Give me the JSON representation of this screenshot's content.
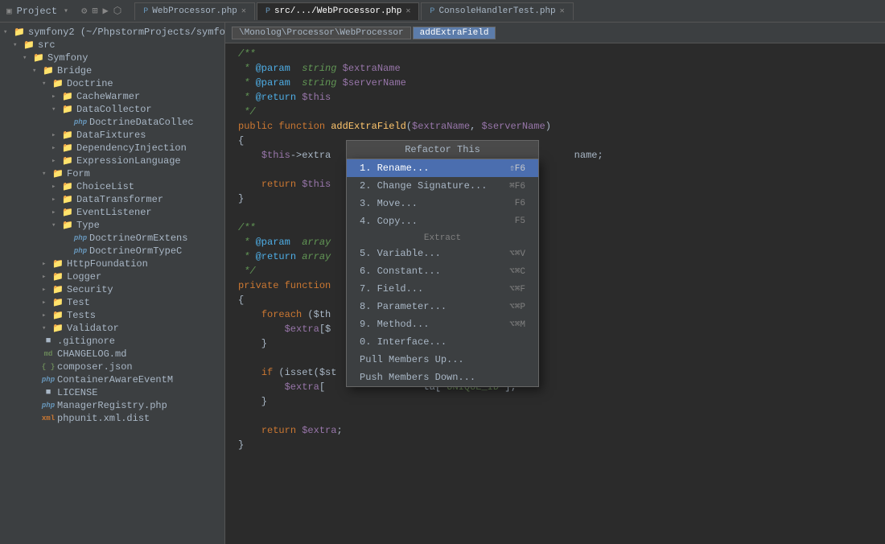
{
  "titlebar": {
    "project_label": "Project",
    "project_path": "symfony2 (~/PhpstormProjects/symfo"
  },
  "tabs": [
    {
      "id": "tab1",
      "label": "WebProcessor.php",
      "active": false,
      "closable": true
    },
    {
      "id": "tab2",
      "label": "src/.../WebProcessor.php",
      "active": true,
      "closable": true
    },
    {
      "id": "tab3",
      "label": "ConsoleHandlerTest.php",
      "active": false,
      "closable": true
    }
  ],
  "breadcrumbs": [
    {
      "label": "\\Monolog\\Processor\\WebProcessor",
      "active": false
    },
    {
      "label": "addExtraField",
      "active": true
    }
  ],
  "sidebar": {
    "items": [
      {
        "id": "symfony2",
        "label": "symfony2 (~/PhpstormProjects/symfo",
        "indent": 0,
        "type": "project",
        "arrow": "▾"
      },
      {
        "id": "src",
        "label": "src",
        "indent": 1,
        "type": "folder-open",
        "arrow": "▾"
      },
      {
        "id": "symfony",
        "label": "Symfony",
        "indent": 2,
        "type": "folder-open",
        "arrow": "▾"
      },
      {
        "id": "bridge",
        "label": "Bridge",
        "indent": 3,
        "type": "folder-open",
        "arrow": "▾"
      },
      {
        "id": "doctrine",
        "label": "Doctrine",
        "indent": 4,
        "type": "folder-open",
        "arrow": "▾"
      },
      {
        "id": "cachewarmer",
        "label": "CacheWarmer",
        "indent": 5,
        "type": "folder",
        "arrow": "▸"
      },
      {
        "id": "datacollector",
        "label": "DataCollector",
        "indent": 5,
        "type": "folder-open",
        "arrow": "▾"
      },
      {
        "id": "doctrinedatacollec",
        "label": "DoctrineDataCollec",
        "indent": 6,
        "type": "php-file",
        "arrow": ""
      },
      {
        "id": "datafixtures",
        "label": "DataFixtures",
        "indent": 5,
        "type": "folder",
        "arrow": "▸"
      },
      {
        "id": "dependencyinjection",
        "label": "DependencyInjection",
        "indent": 5,
        "type": "folder",
        "arrow": "▸"
      },
      {
        "id": "expressionlanguage",
        "label": "ExpressionLanguage",
        "indent": 5,
        "type": "folder",
        "arrow": "▸"
      },
      {
        "id": "form",
        "label": "Form",
        "indent": 4,
        "type": "folder-open",
        "arrow": "▾"
      },
      {
        "id": "choicelist",
        "label": "ChoiceList",
        "indent": 5,
        "type": "folder",
        "arrow": "▸"
      },
      {
        "id": "datatransformer",
        "label": "DataTransformer",
        "indent": 5,
        "type": "folder",
        "arrow": "▸"
      },
      {
        "id": "eventlistener",
        "label": "EventListener",
        "indent": 5,
        "type": "folder",
        "arrow": "▸"
      },
      {
        "id": "type",
        "label": "Type",
        "indent": 5,
        "type": "folder-open",
        "arrow": "▾"
      },
      {
        "id": "doctrineormextens",
        "label": "DoctrineOrmExtens",
        "indent": 6,
        "type": "php-file",
        "arrow": ""
      },
      {
        "id": "doctrineormtypec",
        "label": "DoctrineOrmTypeC",
        "indent": 6,
        "type": "php-file",
        "arrow": ""
      },
      {
        "id": "httpfoundation",
        "label": "HttpFoundation",
        "indent": 4,
        "type": "folder",
        "arrow": "▸"
      },
      {
        "id": "logger",
        "label": "Logger",
        "indent": 4,
        "type": "folder",
        "arrow": "▸"
      },
      {
        "id": "security",
        "label": "Security",
        "indent": 4,
        "type": "folder",
        "arrow": "▸"
      },
      {
        "id": "test",
        "label": "Test",
        "indent": 4,
        "type": "folder",
        "arrow": "▸"
      },
      {
        "id": "tests",
        "label": "Tests",
        "indent": 4,
        "type": "folder",
        "arrow": "▸"
      },
      {
        "id": "validator",
        "label": "Validator",
        "indent": 4,
        "type": "folder-open",
        "arrow": "▾"
      },
      {
        "id": "gitignore",
        "label": ".gitignore",
        "indent": 3,
        "type": "file",
        "arrow": ""
      },
      {
        "id": "changelog",
        "label": "CHANGELOG.md",
        "indent": 3,
        "type": "md-file",
        "arrow": ""
      },
      {
        "id": "composer",
        "label": "composer.json",
        "indent": 3,
        "type": "json-file",
        "arrow": ""
      },
      {
        "id": "containerawareevent",
        "label": "ContainerAwareEventM",
        "indent": 3,
        "type": "php-file",
        "arrow": ""
      },
      {
        "id": "license",
        "label": "LICENSE",
        "indent": 3,
        "type": "file",
        "arrow": ""
      },
      {
        "id": "managerregistry",
        "label": "ManagerRegistry.php",
        "indent": 3,
        "type": "php-file",
        "arrow": ""
      },
      {
        "id": "phpunit",
        "label": "phpunit.xml.dist",
        "indent": 3,
        "type": "xml-file",
        "arrow": ""
      }
    ]
  },
  "context_menu": {
    "title": "Refactor This",
    "items": [
      {
        "id": "rename",
        "label": "1. Rename...",
        "shortcut": "⇧F6",
        "selected": true,
        "section": ""
      },
      {
        "id": "change-sig",
        "label": "2. Change Signature...",
        "shortcut": "⌘F6",
        "selected": false,
        "section": ""
      },
      {
        "id": "move",
        "label": "3. Move...",
        "shortcut": "F6",
        "selected": false,
        "section": ""
      },
      {
        "id": "copy",
        "label": "4. Copy...",
        "shortcut": "F5",
        "selected": false,
        "section": ""
      },
      {
        "id": "extract-section",
        "label": "Extract",
        "shortcut": "",
        "selected": false,
        "section": "header"
      },
      {
        "id": "variable",
        "label": "5. Variable...",
        "shortcut": "⌥⌘V",
        "selected": false,
        "section": ""
      },
      {
        "id": "constant",
        "label": "6. Constant...",
        "shortcut": "⌥⌘C",
        "selected": false,
        "section": ""
      },
      {
        "id": "field",
        "label": "7. Field...",
        "shortcut": "⌥⌘F",
        "selected": false,
        "section": ""
      },
      {
        "id": "parameter",
        "label": "8. Parameter...",
        "shortcut": "⌥⌘P",
        "selected": false,
        "section": ""
      },
      {
        "id": "method",
        "label": "9. Method...",
        "shortcut": "⌥⌘M",
        "selected": false,
        "section": ""
      },
      {
        "id": "interface",
        "label": "0. Interface...",
        "shortcut": "",
        "selected": false,
        "section": ""
      },
      {
        "id": "pull-members",
        "label": "Pull Members Up...",
        "shortcut": "",
        "selected": false,
        "section": ""
      },
      {
        "id": "push-members",
        "label": "Push Members Down...",
        "shortcut": "",
        "selected": false,
        "section": ""
      }
    ]
  },
  "code_lines": [
    {
      "num": "",
      "content": "  /**"
    },
    {
      "num": "",
      "content": "   * @param  string $extraName"
    },
    {
      "num": "",
      "content": "   * @param  string $serverName"
    },
    {
      "num": "",
      "content": "   * @return $this"
    },
    {
      "num": "",
      "content": "   */"
    },
    {
      "num": "",
      "content": "  public function addExtraField($extraName, $serverName)"
    },
    {
      "num": "",
      "content": "  {"
    },
    {
      "num": "",
      "content": "      $this->extra                                          name;"
    },
    {
      "num": "",
      "content": ""
    },
    {
      "num": "",
      "content": "      return $this"
    },
    {
      "num": "",
      "content": "  }"
    },
    {
      "num": "",
      "content": ""
    },
    {
      "num": "",
      "content": "  /**"
    },
    {
      "num": "",
      "content": "   * @param  array"
    },
    {
      "num": "",
      "content": "   * @return array"
    },
    {
      "num": "",
      "content": "   */"
    },
    {
      "num": "",
      "content": "  private function"
    },
    {
      "num": "",
      "content": "  {"
    },
    {
      "num": "",
      "content": "      foreach ($th                    ra)"
    },
    {
      "num": "",
      "content": "          $extra[$                  => $serverName) {"
    },
    {
      "num": "",
      "content": "      }"
    },
    {
      "num": "",
      "content": ""
    },
    {
      "num": "",
      "content": "      if (isset($st                         ) {"
    },
    {
      "num": "",
      "content": "          $extra[                 ta['UNIQUE_ID'];"
    },
    {
      "num": "",
      "content": "      }"
    },
    {
      "num": "",
      "content": ""
    },
    {
      "num": "",
      "content": "      return $extra;"
    },
    {
      "num": "",
      "content": "  }"
    }
  ]
}
